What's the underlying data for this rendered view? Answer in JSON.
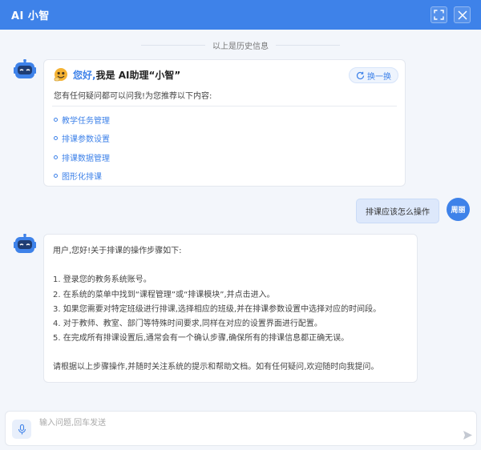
{
  "window": {
    "title": "AI 小智"
  },
  "history": {
    "note": "以上是历史信息"
  },
  "welcome": {
    "greeting_hi": "您好,",
    "greeting_rest": "我是 AI助理“小智”",
    "intro": "您有任何疑问都可以问我!为您推荐以下内容:",
    "swap_label": "换一换",
    "suggestions": [
      "教学任务管理",
      "排课参数设置",
      "排课数据管理",
      "图形化排课"
    ]
  },
  "user_message": {
    "text": "排课应该怎么操作",
    "avatar_label": "周丽"
  },
  "reply": {
    "lines": [
      "用户,您好!关于排课的操作步骤如下:",
      "1. 登录您的教务系统账号。",
      "2. 在系统的菜单中找到“课程管理”或“排课模块”,并点击进入。",
      "3. 如果您需要对特定班级进行排课,选择相应的班级,并在排课参数设置中选择对应的时间段。",
      "4. 对于教师、教室、部门等特殊时间要求,同样在对应的设置界面进行配置。",
      "5. 在完成所有排课设置后,通常会有一个确认步骤,确保所有的排课信息都正确无误。",
      "请根据以上步骤操作,并随时关注系统的提示和帮助文档。如有任何疑问,欢迎随时向我提问。"
    ]
  },
  "composer": {
    "placeholder": "输入问题,回车发送"
  },
  "colors": {
    "accent": "#3e82e9",
    "background": "#f3f6fb",
    "user_bubble": "#dde8fb"
  },
  "icons": [
    "expand-icon",
    "close-icon",
    "robot-avatar-icon",
    "emoji-icon",
    "refresh-icon",
    "mic-icon",
    "send-icon"
  ]
}
